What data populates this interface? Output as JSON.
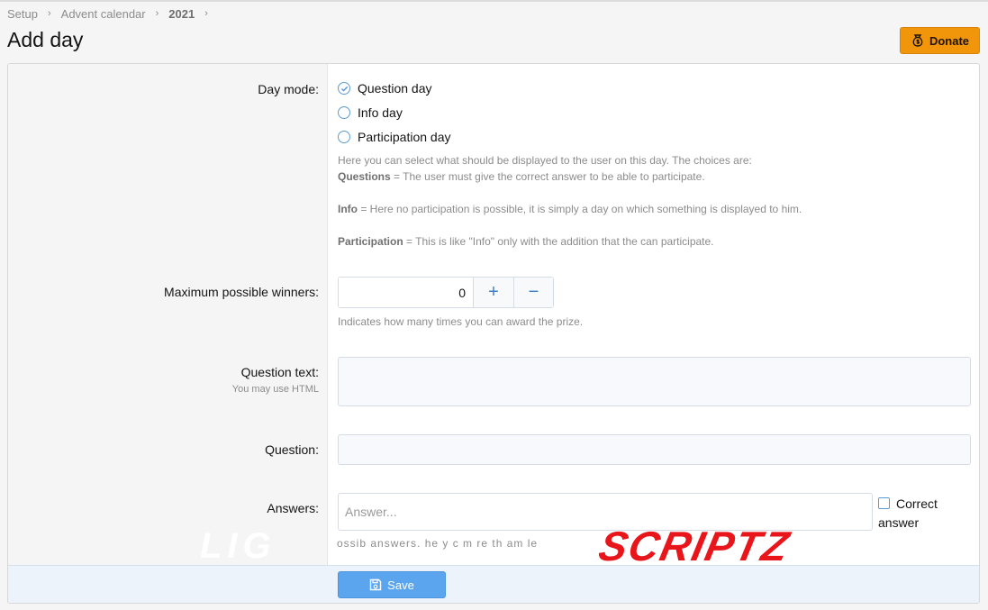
{
  "breadcrumb": {
    "items": [
      "Setup",
      "Advent calendar",
      "2021"
    ],
    "separator": "›"
  },
  "page": {
    "title": "Add day"
  },
  "donate_button": {
    "label": "Donate"
  },
  "form": {
    "day_mode": {
      "label": "Day mode:",
      "options": [
        "Question day",
        "Info day",
        "Participation day"
      ],
      "selected": "Question day",
      "help": {
        "intro": "Here you can select what should be displayed to the user on this day. The choices are:",
        "questions_term": "Questions",
        "questions_desc": " = The user must give the correct answer to be able to participate.",
        "info_term": "Info",
        "info_desc": " = Here no participation is possible, it is simply a day on which something is displayed to him.",
        "participation_term": "Participation",
        "participation_desc": " = This is like \"Info\" only with the addition that the can participate."
      }
    },
    "max_winners": {
      "label": "Maximum possible winners:",
      "value": "0",
      "plus": "+",
      "minus": "−",
      "help": "Indicates how many times you can award the prize."
    },
    "question_text": {
      "label": "Question text:",
      "sublabel": "You may use HTML"
    },
    "question": {
      "label": "Question:"
    },
    "answers": {
      "label": "Answers:",
      "placeholder": "Answer...",
      "correct_label": "Correct answer",
      "help_partial": "ossib  answers. he  y  c  m  re    th   am  le"
    }
  },
  "save_button": {
    "label": "Save"
  },
  "watermark": {
    "left_text": "LIG",
    "right_text": "SCRIPTZ"
  },
  "colors": {
    "accent_blue": "#5aa5ee",
    "donate_orange": "#f1950b",
    "watermark_red": "#e8151b"
  }
}
